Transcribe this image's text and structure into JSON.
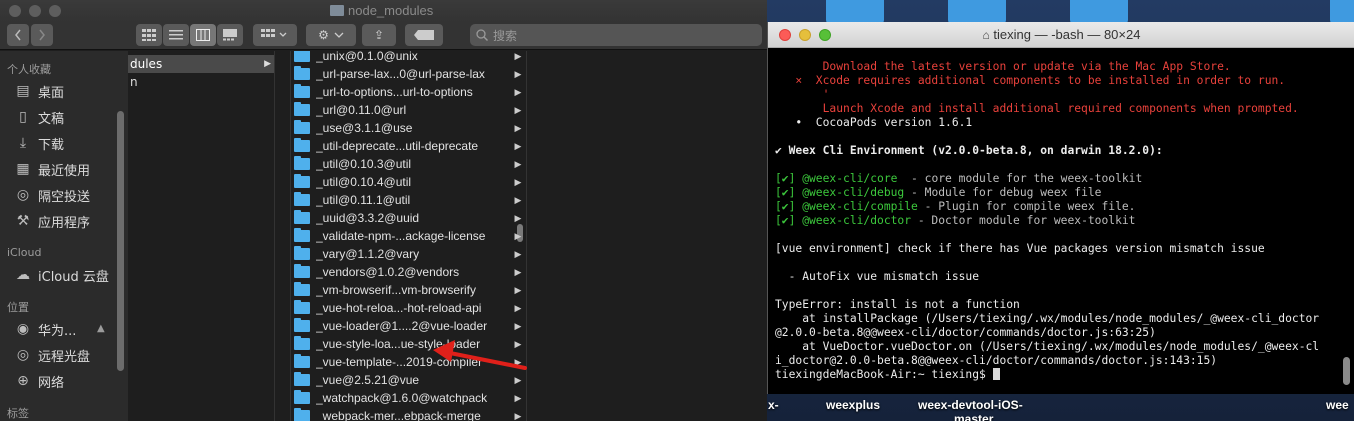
{
  "desktop": {
    "labels": [
      "x-",
      "weexplus",
      "weex-devtool-iOS-",
      "master",
      "wee"
    ]
  },
  "finder": {
    "title": "node_modules",
    "search_placeholder": "搜索",
    "toolbar": {
      "action_glyph": "⚙",
      "share_glyph": "⇪"
    },
    "sidebar": {
      "favorites_header": "个人收藏",
      "favorites": [
        {
          "label": "桌面",
          "icon": "desktop-icon",
          "glyph": "▤"
        },
        {
          "label": "文稿",
          "icon": "documents-icon",
          "glyph": "▯"
        },
        {
          "label": "下载",
          "icon": "downloads-icon",
          "glyph": "⤓"
        },
        {
          "label": "最近使用",
          "icon": "recents-icon",
          "glyph": "▦"
        },
        {
          "label": "隔空投送",
          "icon": "airdrop-icon",
          "glyph": "◎"
        },
        {
          "label": "应用程序",
          "icon": "applications-icon",
          "glyph": "⚒"
        }
      ],
      "icloud_header": "iCloud",
      "icloud": [
        {
          "label": "iCloud 云盘",
          "icon": "cloud-icon",
          "glyph": "☁"
        }
      ],
      "locations_header": "位置",
      "locations": [
        {
          "label": "华为...",
          "icon": "disk-icon",
          "glyph": "◉"
        },
        {
          "label": "远程光盘",
          "icon": "disc-icon",
          "glyph": "◎"
        },
        {
          "label": "网络",
          "icon": "network-icon",
          "glyph": "⊕"
        }
      ],
      "tags_header": "标签"
    },
    "column1": {
      "selected": "dules",
      "next": "n"
    },
    "files": [
      "_unix@0.1.0@unix",
      "_url-parse-lax...0@url-parse-lax",
      "_url-to-options...url-to-options",
      "_url@0.11.0@url",
      "_use@3.1.1@use",
      "_util-deprecate...util-deprecate",
      "_util@0.10.3@util",
      "_util@0.10.4@util",
      "_util@0.11.1@util",
      "_uuid@3.3.2@uuid",
      "_validate-npm-...ackage-license",
      "_vary@1.1.2@vary",
      "_vendors@1.0.2@vendors",
      "_vm-browserif...vm-browserify",
      "_vue-hot-reloa...-hot-reload-api",
      "_vue-loader@1....2@vue-loader",
      "_vue-style-loa...ue-style-loader",
      "_vue-template-...2019-compiler",
      "_vue@2.5.21@vue",
      "_watchpack@1.6.0@watchpack",
      "_webpack-mer...ebpack-merge"
    ],
    "arrow_glyph": "▶"
  },
  "terminal": {
    "title": "tiexing — -bash — 80×24",
    "home_glyph": "⌂",
    "lines": [
      {
        "text": "       Download the latest version or update via the Mac App Store.",
        "color": "red"
      },
      {
        "text": "   ×  Xcode requires additional components to be installed in order to run.",
        "color": "red"
      },
      {
        "text": "       ' ",
        "color": "red"
      },
      {
        "text": "       Launch Xcode and install additional required components when prompted.",
        "color": "red"
      },
      {
        "text": "   •  CocoaPods version 1.6.1",
        "color": "white"
      },
      {
        "text": "",
        "color": "white"
      },
      {
        "text": "✔ Weex Cli Environment (v2.0.0-beta.8, on darwin 18.2.0):",
        "color": "white",
        "bold": true
      },
      {
        "text": "",
        "color": "white"
      },
      {
        "text": "[✔] @weex-cli/core",
        "suffix": "  - core module for the weex-toolkit",
        "color": "green"
      },
      {
        "text": "[✔] @weex-cli/debug",
        "suffix": " - Module for debug weex file",
        "color": "green"
      },
      {
        "text": "[✔] @weex-cli/compile",
        "suffix": " - Plugin for compile weex file.",
        "color": "green"
      },
      {
        "text": "[✔] @weex-cli/doctor",
        "suffix": " - Doctor module for weex-toolkit",
        "color": "green"
      },
      {
        "text": "",
        "color": "white"
      },
      {
        "text": "[vue environment] check if there has Vue packages version mismatch issue",
        "color": "white"
      },
      {
        "text": "",
        "color": "white"
      },
      {
        "text": "  - AutoFix vue mismatch issue",
        "color": "white"
      },
      {
        "text": "",
        "color": "white"
      },
      {
        "text": "TypeError: install is not a function",
        "color": "white"
      },
      {
        "text": "    at installPackage (/Users/tiexing/.wx/modules/node_modules/_@weex-cli_doctor",
        "color": "white"
      },
      {
        "text": "@2.0.0-beta.8@@weex-cli/doctor/commands/doctor.js:63:25)",
        "color": "white"
      },
      {
        "text": "    at VueDoctor.vueDoctor.on (/Users/tiexing/.wx/modules/node_modules/_@weex-cl",
        "color": "white"
      },
      {
        "text": "i_doctor@2.0.0-beta.8@@weex-cli/doctor/commands/doctor.js:143:15)",
        "color": "white"
      },
      {
        "text": "tiexingdeMacBook-Air:~ tiexing$ ",
        "color": "white",
        "prompt": true
      }
    ]
  }
}
